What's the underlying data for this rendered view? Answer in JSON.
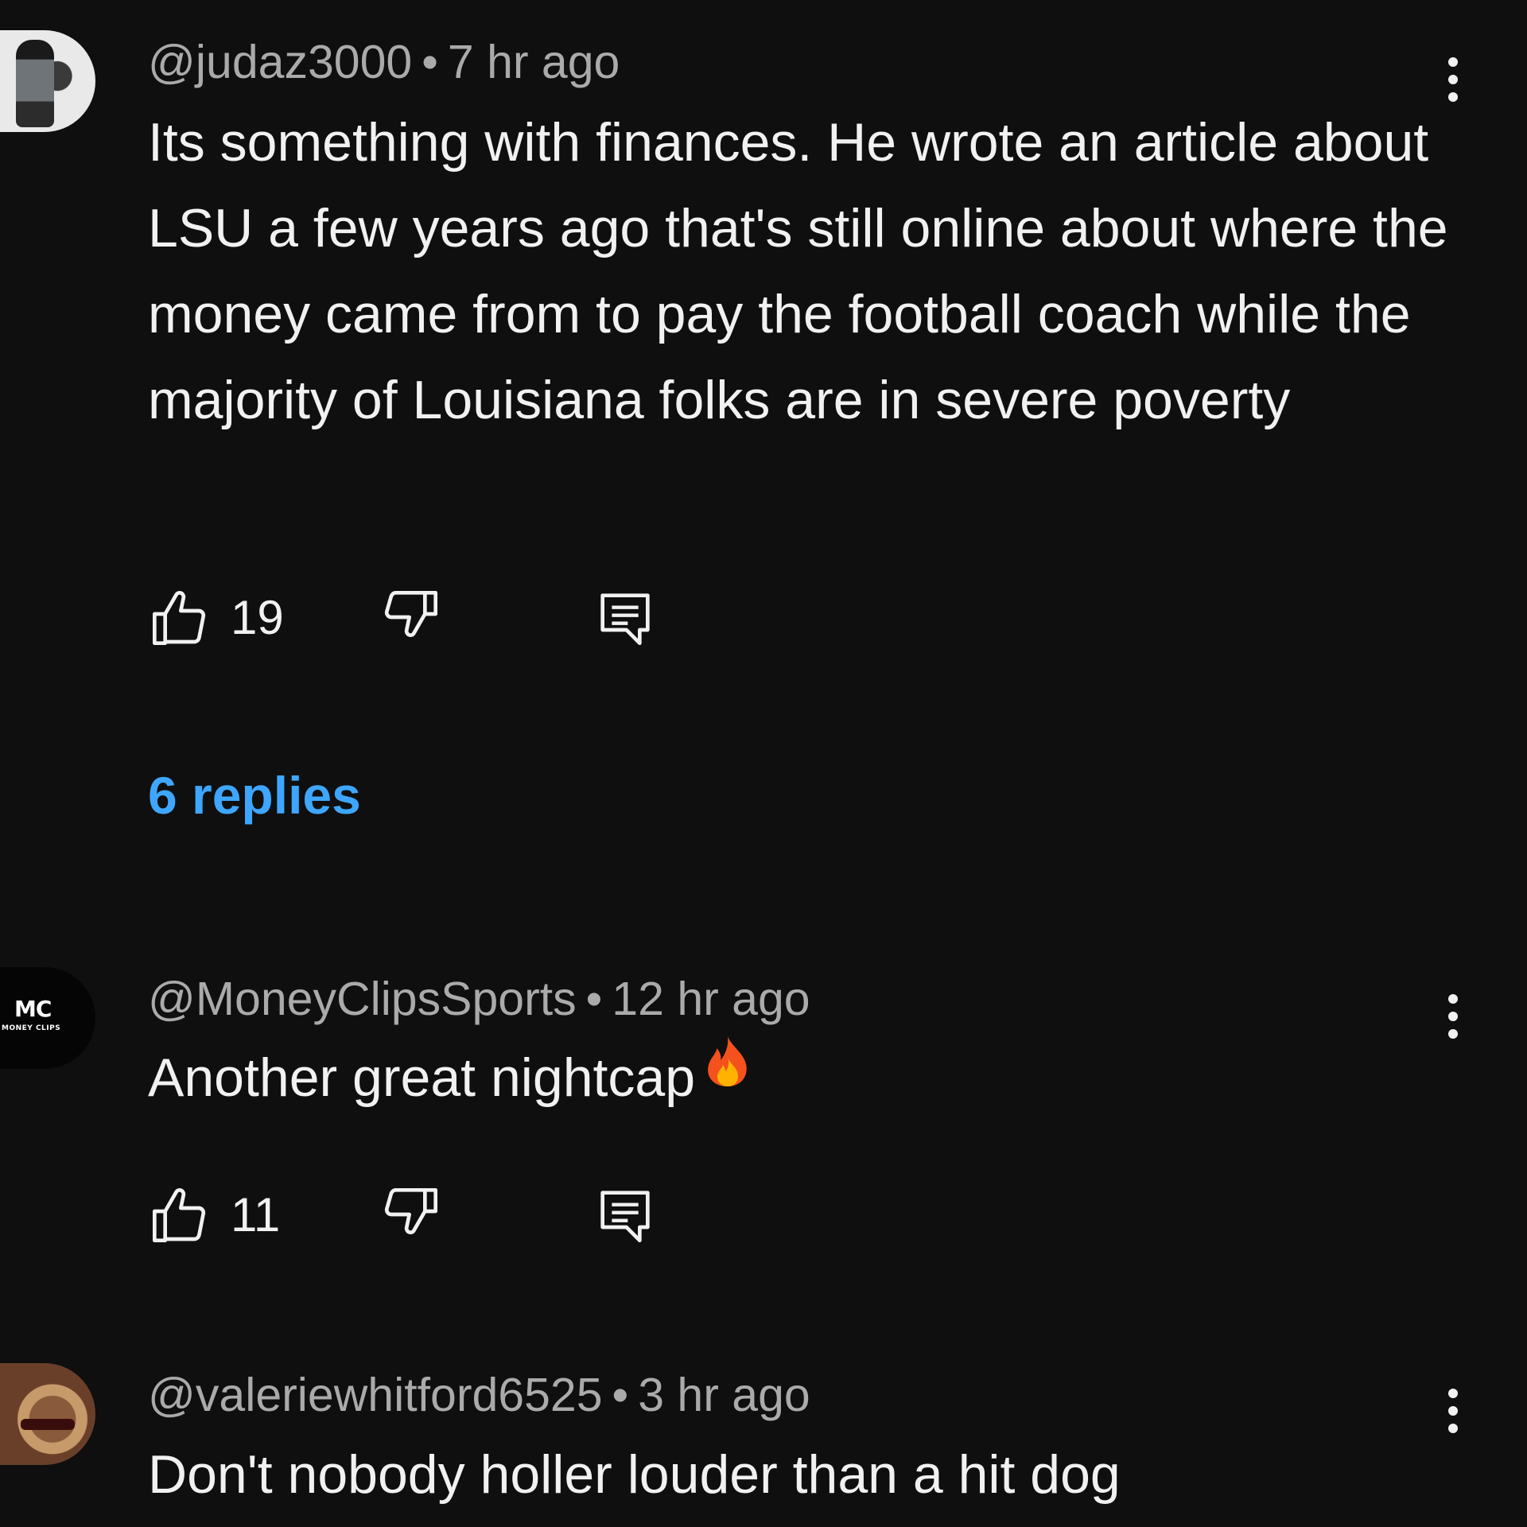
{
  "comments": [
    {
      "author": "@judaz3000",
      "separator": "•",
      "time": "7 hr ago",
      "text": "Its something with finances. He wrote an article about LSU a few years ago that's still online about where the money came from to pay the football coach while the majority of Louisiana folks are in severe poverty",
      "likes": "19",
      "replies_label": "6 replies",
      "icons": [
        "avatar",
        "thumbs-up-icon",
        "thumbs-down-icon",
        "reply-icon",
        "more-vert-icon"
      ]
    },
    {
      "author": "@MoneyClipsSports",
      "separator": "•",
      "time": "12 hr ago",
      "text": "Another great nightcap",
      "emoji": "fire-emoji",
      "likes": "11",
      "avatar_logo": "MC",
      "avatar_logo_sub": "MONEY CLIPS",
      "icons": [
        "avatar",
        "thumbs-up-icon",
        "thumbs-down-icon",
        "reply-icon",
        "more-vert-icon"
      ]
    },
    {
      "author": "@valeriewhitford6525",
      "separator": "•",
      "time": "3 hr ago",
      "text": "Don't nobody holler louder than a hit dog",
      "icons": [
        "avatar",
        "more-vert-icon"
      ]
    }
  ],
  "colors": {
    "background": "#0f0f0f",
    "text": "#f1f1f1",
    "meta": "#aaaaaa",
    "link": "#3ea6ff"
  }
}
